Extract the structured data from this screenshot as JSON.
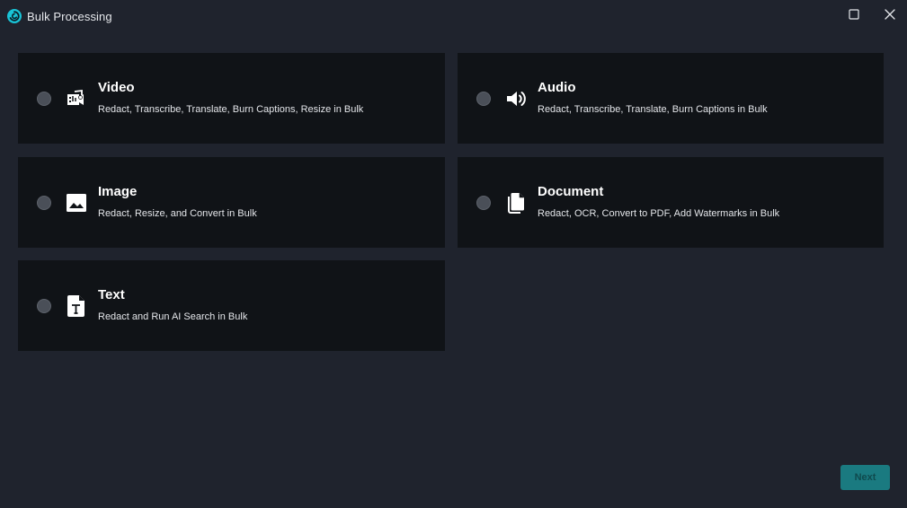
{
  "window": {
    "title": "Bulk Processing"
  },
  "options": [
    {
      "id": "video",
      "title": "Video",
      "description": "Redact, Transcribe, Translate, Burn Captions, Resize in Bulk",
      "icon": "video-audio-icon"
    },
    {
      "id": "audio",
      "title": "Audio",
      "description": "Redact, Transcribe, Translate, Burn Captions in Bulk",
      "icon": "speaker-icon"
    },
    {
      "id": "image",
      "title": "Image",
      "description": "Redact, Resize, and Convert in Bulk",
      "icon": "image-icon"
    },
    {
      "id": "document",
      "title": "Document",
      "description": "Redact, OCR, Convert to PDF, Add Watermarks in Bulk",
      "icon": "document-copy-icon"
    },
    {
      "id": "text",
      "title": "Text",
      "description": "Redact and Run AI Search in Bulk",
      "icon": "text-file-icon"
    }
  ],
  "footer": {
    "next_label": "Next"
  },
  "colors": {
    "background": "#1f232d",
    "card": "#101317",
    "accent": "#1a7a80",
    "logo": "#19c3d6"
  }
}
